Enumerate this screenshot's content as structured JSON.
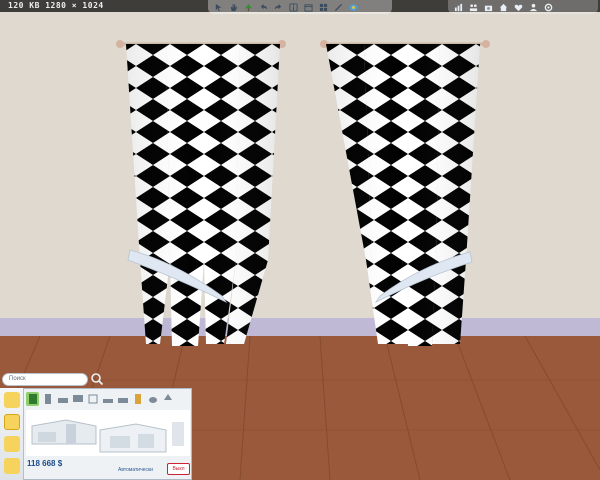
{
  "top_bar": {
    "resolution": "120 KB 1280 × 1024"
  },
  "toolbar_left": {
    "icons": [
      "pointer-icon",
      "hand-icon",
      "tree-icon",
      "undo-icon",
      "redo-icon",
      "info-icon",
      "inventory-icon",
      "grid-icon",
      "eyedropper-icon",
      "paint-icon"
    ]
  },
  "toolbar_right": {
    "icons": [
      "chart-icon",
      "family-icon",
      "camera-icon",
      "house-icon",
      "heart-icon",
      "person-icon",
      "settings-icon"
    ]
  },
  "catalog": {
    "search_placeholder": "Поиск",
    "price": "118 668 $",
    "auto_label": "Автоматически",
    "off_label": "Выкл"
  },
  "colors": {
    "wall": "#dfd9d0",
    "floor": "#9a5a35",
    "baseboard": "#bfb9d6",
    "navy": "#2e3f8f",
    "mustard": "#c7a72b",
    "sky": "#9cc7ea",
    "pink": "#f0c0b3"
  }
}
